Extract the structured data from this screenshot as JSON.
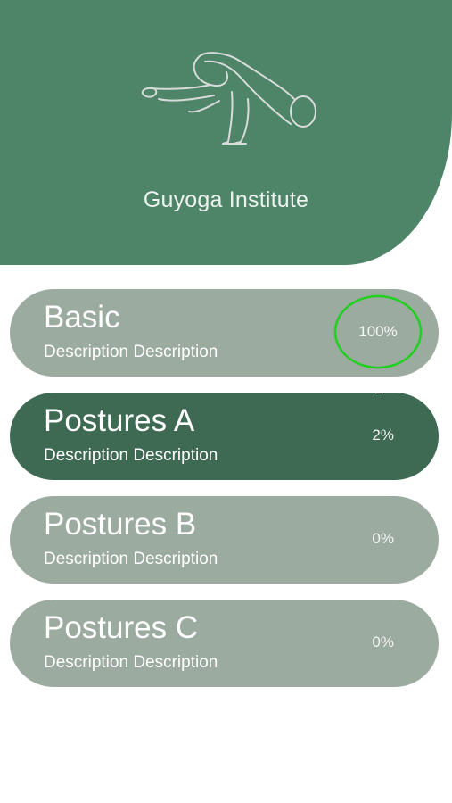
{
  "header": {
    "brand": "Guyoga Institute",
    "logo_icon": "yoga-crow-pose-icon",
    "background": "#4e8468"
  },
  "courses": [
    {
      "title": "Basic",
      "description": "Description Description",
      "progress_label": "100%",
      "progress": 1.0,
      "ring_color": "#1fd01f"
    },
    {
      "title": "Postures A",
      "description": "Description Description",
      "progress_label": "2%",
      "progress": 0.02
    },
    {
      "title": "Postures B",
      "description": "Description Description",
      "progress_label": "0%",
      "progress": 0.0
    },
    {
      "title": "Postures C",
      "description": "Description Description",
      "progress_label": "0%",
      "progress": 0.0
    }
  ],
  "colors": {
    "card": "#9cab9f",
    "card_active": "#3e6a53",
    "complete_ring": "#1fd01f"
  }
}
